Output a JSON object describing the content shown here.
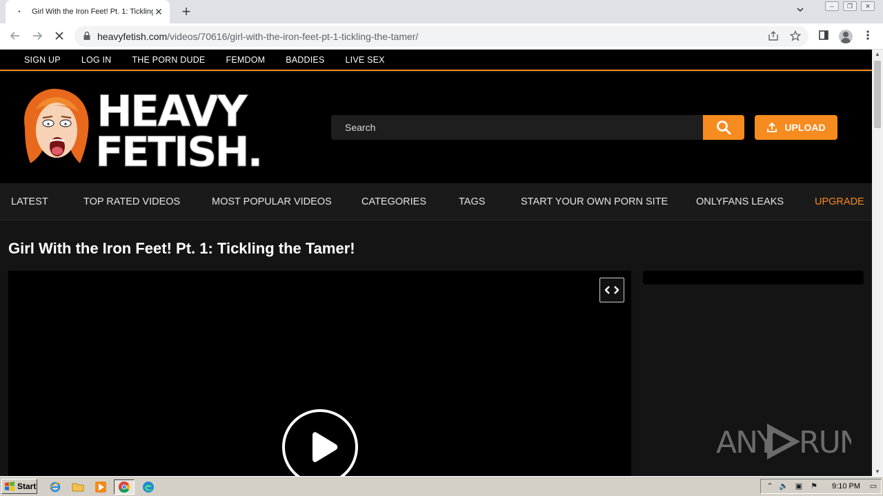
{
  "browser": {
    "tab_title": "Girl With the Iron Feet! Pt. 1: Tickling the Tamer!",
    "url_host": "heavyfetish.com",
    "url_path": "/videos/70616/girl-with-the-iron-feet-pt-1-tickling-the-tamer/"
  },
  "topnav": {
    "items": [
      "SIGN UP",
      "LOG IN",
      "THE PORN DUDE",
      "FEMDOM",
      "BADDIES",
      "LIVE SEX"
    ]
  },
  "header": {
    "logo_line1": "HEAVY",
    "logo_line2": "FETISH.",
    "search_placeholder": "Search",
    "upload_label": "UPLOAD"
  },
  "mainnav": {
    "items": [
      "LATEST",
      "TOP RATED VIDEOS",
      "MOST POPULAR VIDEOS",
      "CATEGORIES",
      "TAGS",
      "START YOUR OWN PORN SITE",
      "ONLYFANS LEAKS",
      "UPGRADE"
    ]
  },
  "video": {
    "title": "Girl With the Iron Feet! Pt. 1: Tickling the Tamer!"
  },
  "watermark": {
    "text_left": "ANY",
    "text_right": "RUN"
  },
  "taskbar": {
    "start_label": "Start",
    "clock": "9:10 PM"
  },
  "colors": {
    "accent": "#f68b1f",
    "page_bg": "#141414",
    "header_bg": "#000000",
    "nav_bg": "#1a1a1a"
  }
}
